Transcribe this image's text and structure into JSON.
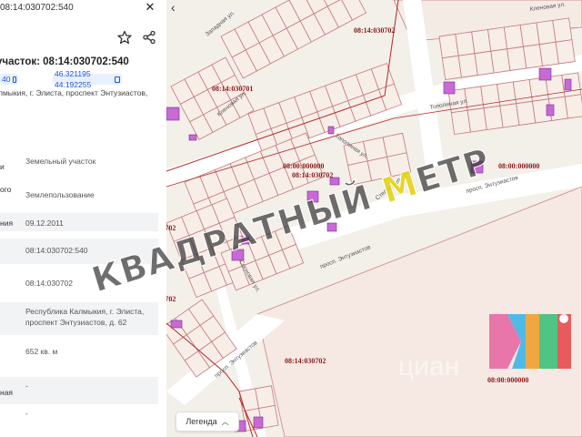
{
  "panel": {
    "tab_code": "08:14:030702:540",
    "title": "участок: 08:14:030702:540",
    "chip_cadastral": "40",
    "chip_coords": "46.321195 44.192255",
    "address_line": "лмыкия, г. Элиста, проспект Энтузиастов,",
    "rows": [
      {
        "label": "и",
        "value": "Земельный участок"
      },
      {
        "label": "ого",
        "value": "Землепользование"
      },
      {
        "label": "ния",
        "value": "09.12.2011"
      },
      {
        "label": "",
        "value": "08:14:030702:540"
      },
      {
        "label": "",
        "value": "08:14:030702"
      },
      {
        "label": "",
        "value": "Республика Калмыкия, г. Элиста, проспект Энтузиастов, д. 62"
      },
      {
        "label": "",
        "value": "652 кв. м"
      },
      {
        "label": "ная",
        "value": "-"
      },
      {
        "label": "",
        "value": "-"
      }
    ]
  },
  "map": {
    "street_labels": [
      "Западная ул.",
      "Кленовая ул.",
      "Тополиная ул.",
      "Тополиная ул.",
      "просп. Энтузиастов",
      "просп. Энтузиастов",
      "просп. Энтузиастов",
      "Степная ул.",
      "Сосновая ул.",
      "Кленовая ул."
    ],
    "quarter_labels": [
      "08:14:030702",
      "08:14:030701",
      "08:00:000000",
      "08:14:030702",
      "08:00:000000",
      "08:14:030702",
      "08:14:030702",
      "08:00:000000",
      "08:14:030702",
      "08:00:000000"
    ],
    "legend_label": "Легенда",
    "brand_text": "циан"
  },
  "watermark": {
    "part1": "КВАДРАТНЫЙ",
    "part2": "М",
    "part3": "ЕТР"
  },
  "colors": {
    "parcel_line": "#c47a7a",
    "quarter_text": "#8b1a1a",
    "building_fill": "#c86ad6",
    "street_fill": "#ffffff",
    "parcel_fill": "#f7eee8"
  }
}
